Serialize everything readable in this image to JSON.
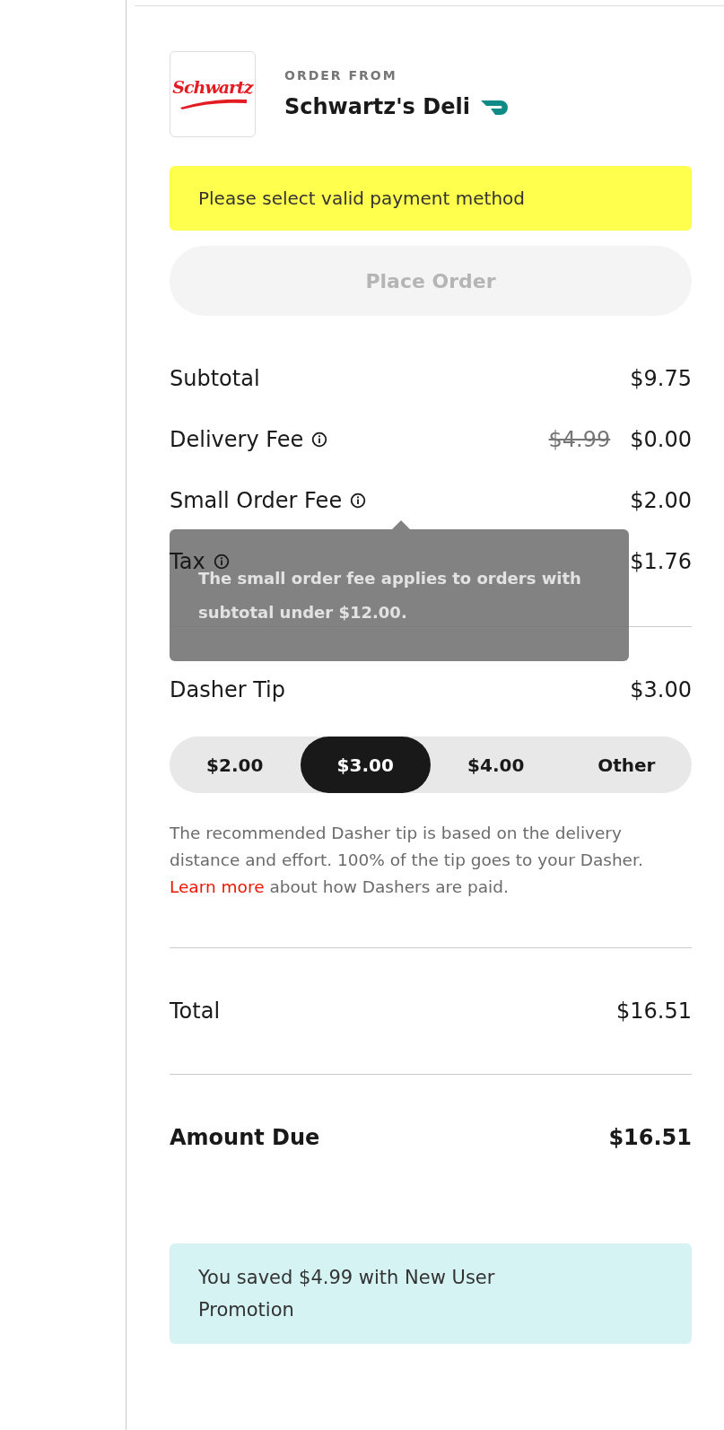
{
  "store": {
    "logo_text": "Schwartz",
    "caption": "ORDER FROM",
    "name": "Schwartz's Deli"
  },
  "alert": "Please select valid payment method",
  "place_order": {
    "label": "Place Order",
    "disabled": true
  },
  "fees": [
    {
      "label": "Subtotal",
      "info": false,
      "value": "$9.75"
    },
    {
      "label": "Delivery Fee",
      "info": true,
      "original": "$4.99",
      "value": "$0.00"
    },
    {
      "label": "Small Order Fee",
      "info": true,
      "value": "$2.00"
    },
    {
      "label": "Tax",
      "info": true,
      "value": "$1.76"
    }
  ],
  "tooltip": "The small order fee applies to orders with subtotal under $12.00.",
  "tip": {
    "label": "Dasher Tip",
    "value": "$3.00",
    "options": [
      {
        "label": "$2.00",
        "selected": false
      },
      {
        "label": "$3.00",
        "selected": true
      },
      {
        "label": "$4.00",
        "selected": false
      },
      {
        "label": "Other",
        "selected": false
      }
    ],
    "note_before": "The recommended Dasher tip is based on the delivery distance and effort. 100% of the tip goes to your Dasher.",
    "link": "Learn more",
    "note_after": "about how Dashers are paid."
  },
  "total": {
    "label": "Total",
    "value": "$16.51"
  },
  "amount_due": {
    "label": "Amount Due",
    "value": "$16.51"
  },
  "promo": "You saved $4.99 with New User Promotion"
}
